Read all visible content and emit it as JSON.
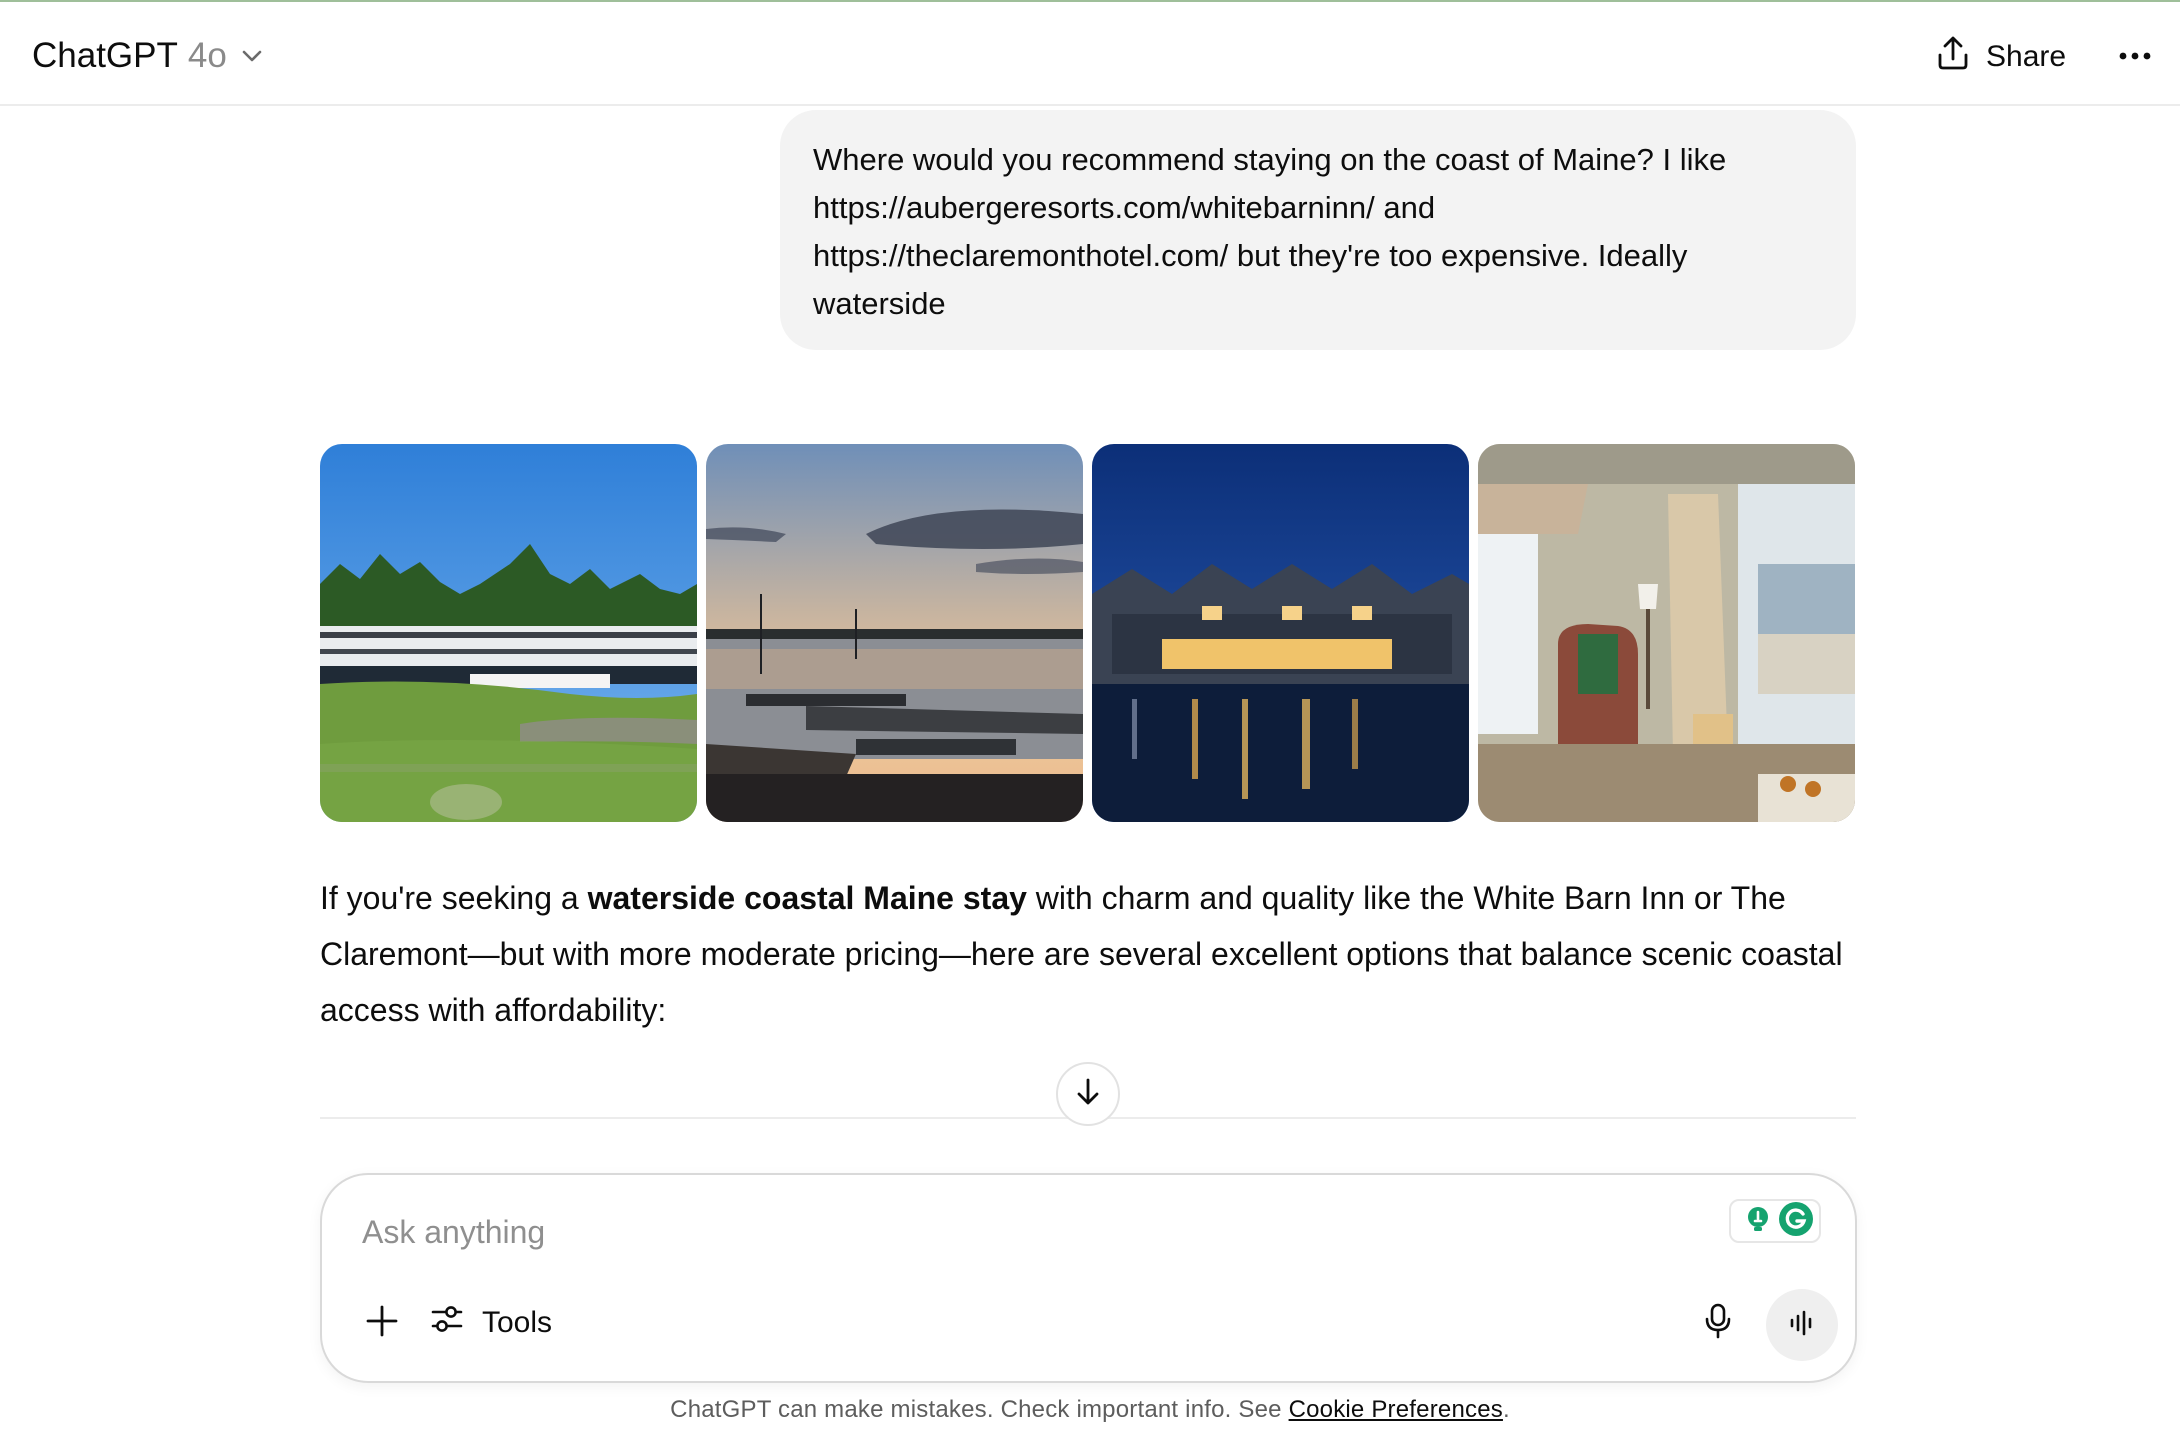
{
  "header": {
    "app_name": "ChatGPT",
    "model": "4o",
    "share_label": "Share"
  },
  "conversation": {
    "user_message": "Where would you recommend staying on the coast of Maine? I like\nhttps://aubergeresorts.com/whitebarninn/ and\nhttps://theclaremonthotel.com/ but they're too expensive. Ideally\nwaterside",
    "images": [
      {
        "icon": "hotel-lawn-photo"
      },
      {
        "icon": "harbor-sunset-photo"
      },
      {
        "icon": "waterfront-inn-night-photo"
      },
      {
        "icon": "ocean-view-room-photo"
      }
    ],
    "answer": {
      "intro": "If you're seeking a ",
      "bold": "waterside coastal Maine stay",
      "rest": " with charm and quality like the White Barn Inn or The Claremont—but with more moderate pricing—here are several excellent options that balance scenic coastal access with affordability:"
    }
  },
  "composer": {
    "placeholder": "Ask anything",
    "tools_label": "Tools"
  },
  "footer": {
    "note": "ChatGPT can make mistakes. Check important info. See ",
    "link_label": "Cookie Preferences",
    "end": "."
  },
  "colors": {
    "bubble_bg": "#f3f3f3",
    "border": "#d9d9d9",
    "muted_text": "#8a8a8a",
    "grammarly_green": "#15a36f"
  }
}
